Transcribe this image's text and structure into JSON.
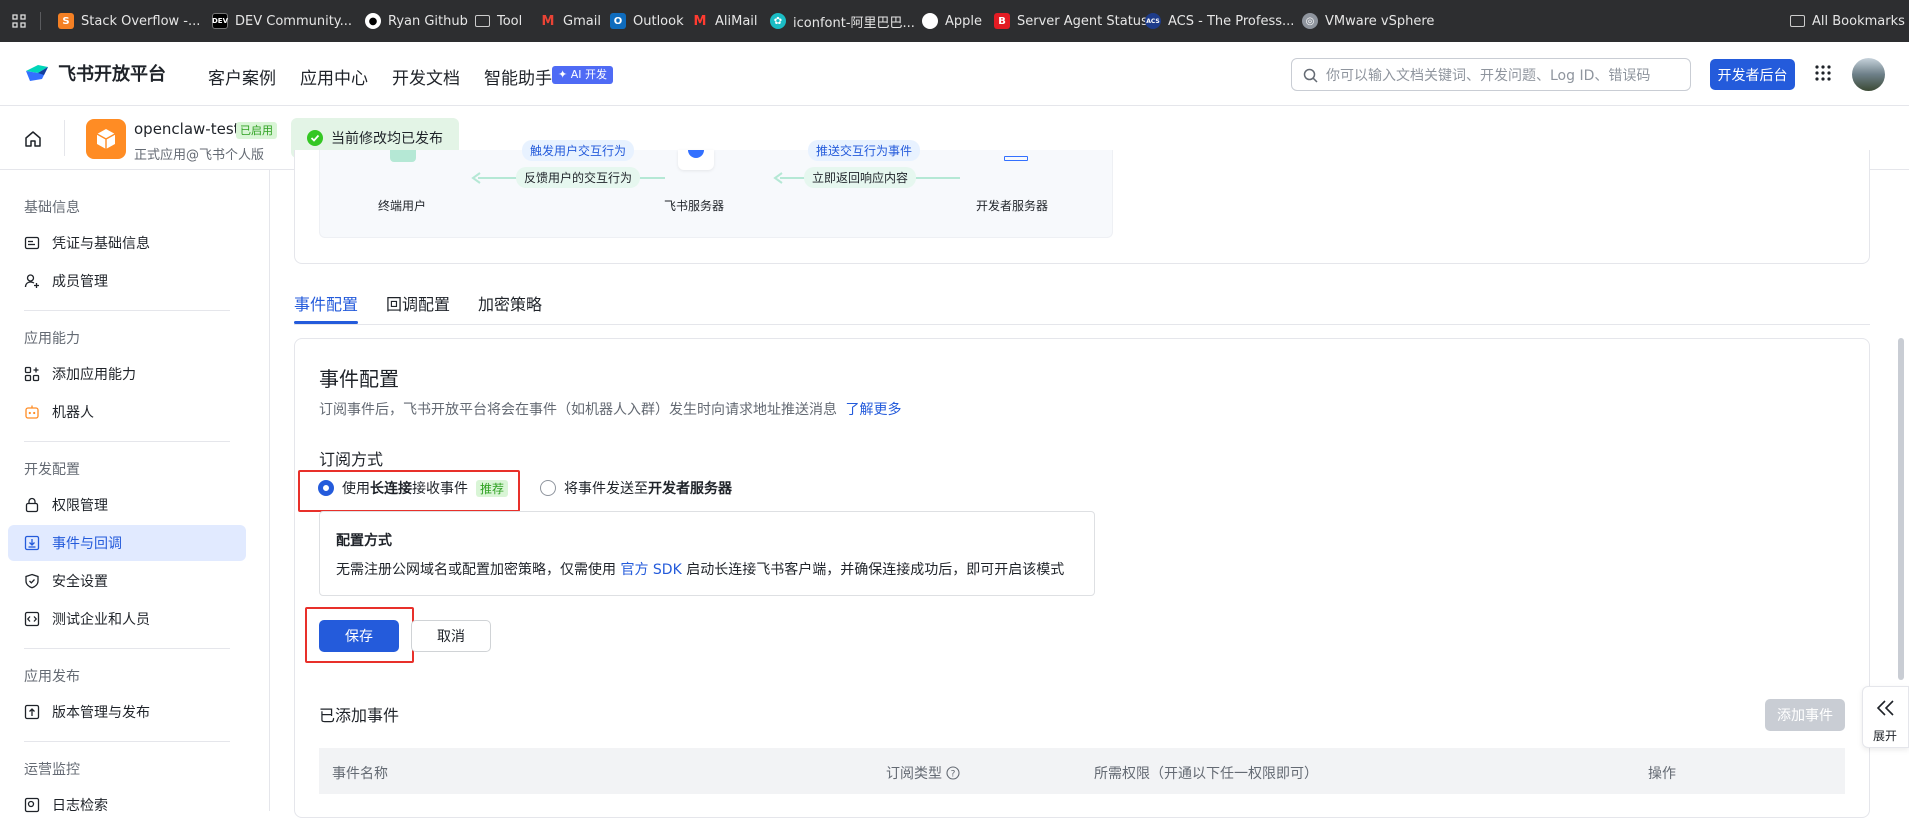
{
  "bookmarks": {
    "items": [
      {
        "label": "Stack Overflow -...",
        "icon": "stackoverflow-icon"
      },
      {
        "label": "DEV Community...",
        "icon": "dev-icon"
      },
      {
        "label": "Ryan Github",
        "icon": "github-icon"
      },
      {
        "label": "Tool",
        "icon": "folder-icon"
      },
      {
        "label": "Gmail",
        "icon": "gmail-icon"
      },
      {
        "label": "Outlook",
        "icon": "outlook-icon"
      },
      {
        "label": "AliMail",
        "icon": "alimail-icon"
      },
      {
        "label": "iconfont-阿里巴巴...",
        "icon": "iconfont-icon"
      },
      {
        "label": "Apple",
        "icon": "apple-icon"
      },
      {
        "label": "Server Agent Status",
        "icon": "server-agent-icon"
      },
      {
        "label": "ACS - The Profess...",
        "icon": "acs-icon"
      },
      {
        "label": "VMware vSphere",
        "icon": "vmware-icon"
      }
    ],
    "all_bookmarks": "All Bookmarks"
  },
  "header": {
    "logo_text": "飞书开放平台",
    "nav": [
      "客户案例",
      "应用中心",
      "开发文档",
      "智能助手"
    ],
    "ai_badge": "✦ AI 开发",
    "search_placeholder": "你可以输入文档关键词、开发问题、Log ID、错误码",
    "dev_console": "开发者后台"
  },
  "app": {
    "name": "openclaw-test",
    "status": "已启用",
    "subtitle": "正式应用@飞书个人版",
    "toast": "当前修改均已发布"
  },
  "sidebar": {
    "groups": [
      {
        "title": "基础信息",
        "items": [
          "凭证与基础信息",
          "成员管理"
        ]
      },
      {
        "title": "应用能力",
        "items": [
          "添加应用能力",
          "机器人"
        ]
      },
      {
        "title": "开发配置",
        "items": [
          "权限管理",
          "事件与回调",
          "安全设置",
          "测试企业和人员"
        ]
      },
      {
        "title": "应用发布",
        "items": [
          "版本管理与发布"
        ]
      },
      {
        "title": "运营监控",
        "items": [
          "日志检索"
        ]
      }
    ],
    "active": "事件与回调"
  },
  "diagram": {
    "top_left_label": "触发用户交互行为",
    "top_right_label": "推送交互行为事件",
    "bottom_left_label": "反馈用户的交互行为",
    "bottom_right_label": "立即返回响应内容",
    "node_user": "终端用户",
    "node_feishu": "飞书服务器",
    "node_dev": "开发者服务器"
  },
  "tabs": [
    "事件配置",
    "回调配置",
    "加密策略"
  ],
  "event_config": {
    "title": "事件配置",
    "desc": "订阅事件后，飞书开放平台将会在事件（如机器人入群）发生时向请求地址推送消息",
    "learn_more": "了解更多",
    "subscribe_label": "订阅方式",
    "option1_prefix": "使用 ",
    "option1_bold": "长连接",
    "option1_suffix": " 接收事件",
    "option1_tag": "推荐",
    "option2_prefix": "将事件发送至 ",
    "option2_bold": "开发者服务器",
    "config_title": "配置方式",
    "config_prefix": "无需注册公网域名或配置加密策略，仅需使用 ",
    "config_link": "官方 SDK",
    "config_suffix": " 启动长连接飞书客户端，并确保连接成功后，即可开启该模式",
    "save": "保存",
    "cancel": "取消"
  },
  "added_events": {
    "title": "已添加事件",
    "add_button": "添加事件",
    "columns": [
      "事件名称",
      "订阅类型",
      "所需权限（开通以下任一权限即可）",
      "操作"
    ]
  },
  "expand_panel": {
    "label": "展开"
  },
  "colors": {
    "primary": "#245bdb",
    "highlight_box": "#e8302a",
    "success_bg": "#e3f4e6"
  }
}
